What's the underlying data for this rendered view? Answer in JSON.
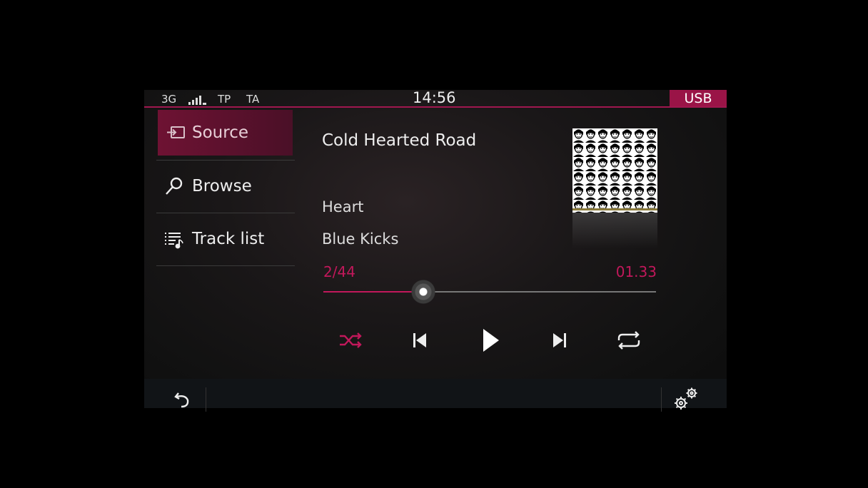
{
  "status": {
    "network": "3G",
    "tp": "TP",
    "ta": "TA",
    "clock": "14:56",
    "source_badge": "USB"
  },
  "menu": {
    "items": [
      {
        "label": "Source",
        "icon": "source-input-icon",
        "active": true
      },
      {
        "label": "Browse",
        "icon": "search-icon",
        "active": false
      },
      {
        "label": "Track list",
        "icon": "track-list-icon",
        "active": false
      }
    ]
  },
  "now_playing": {
    "title": "Cold Hearted Road",
    "artist": "Heart",
    "album": "Blue Kicks",
    "track_position": "2/44",
    "elapsed": "01.33",
    "progress_fraction": 0.3
  },
  "controls": [
    "shuffle-icon",
    "previous-track-icon",
    "play-icon",
    "next-track-icon",
    "repeat-icon"
  ],
  "bottom": [
    "back-icon",
    "settings-icon"
  ],
  "colors": {
    "accent": "#c2185b",
    "badge": "#9a1447"
  }
}
